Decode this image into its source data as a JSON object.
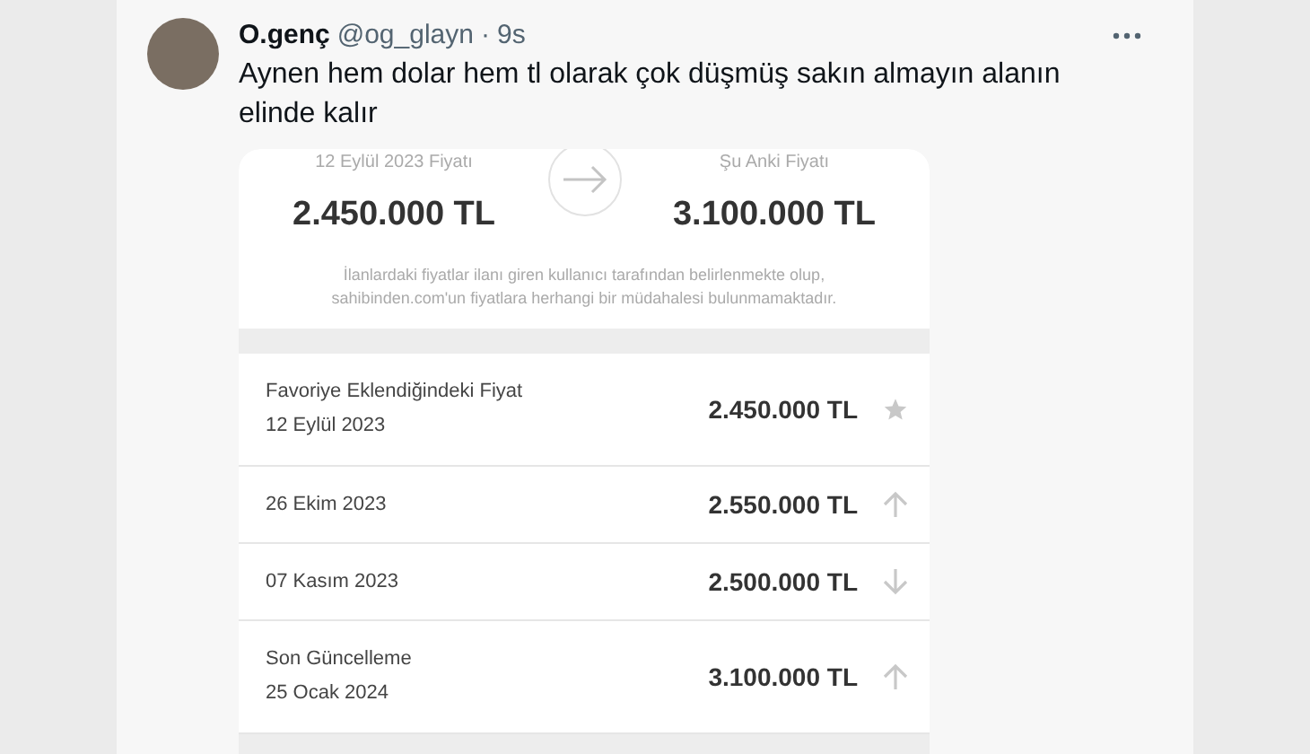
{
  "tweet": {
    "name": "O.genç",
    "handle": "@og_glayn",
    "separator": "·",
    "time": "9s",
    "text": "Aynen hem dolar hem tl olarak çok düşmüş sakın almayın alanın elinde kalır"
  },
  "price_card": {
    "from_label": "12 Eylül 2023 Fiyatı",
    "from_price": "2.450.000 TL",
    "to_label": "Şu Anki Fiyatı",
    "to_price": "3.100.000 TL",
    "disclaimer": "İlanlardaki fiyatlar ilanı giren kullanıcı tarafından belirlenmekte olup, sahibinden.com'un fiyatlara herhangi bir müdahalesi bulunmamaktadır."
  },
  "history": [
    {
      "title": "Favoriye Eklendiğindeki Fiyat",
      "date": "12 Eylül 2023",
      "price": "2.450.000 TL",
      "kind": "favorite"
    },
    {
      "date": "26 Ekim 2023",
      "price": "2.550.000 TL",
      "kind": "up"
    },
    {
      "date": "07 Kasım 2023",
      "price": "2.500.000 TL",
      "kind": "down"
    },
    {
      "title": "Son Güncelleme",
      "date": "25 Ocak 2024",
      "price": "3.100.000 TL",
      "kind": "up"
    }
  ]
}
